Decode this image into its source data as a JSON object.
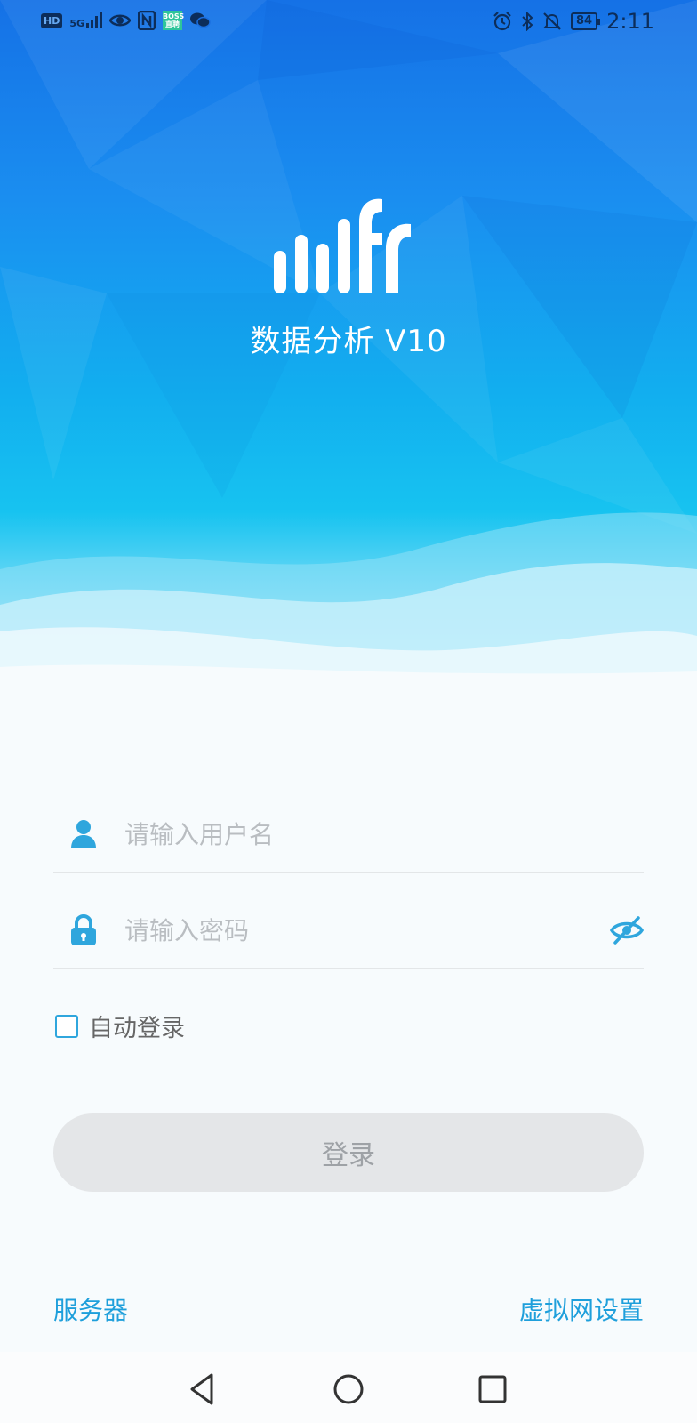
{
  "statusbar": {
    "left_icons": [
      "hd-icon",
      "5g-signal-icon",
      "eye-icon",
      "nfc-icon",
      "boss-app-icon",
      "wechat-icon"
    ],
    "hd_label": "HD",
    "network_label": "5G",
    "boss_label": "BOSS 直聘",
    "right_icons": [
      "alarm-icon",
      "bluetooth-icon",
      "mute-bell-icon",
      "battery-icon"
    ],
    "battery_level": "84",
    "time": "2:11"
  },
  "app": {
    "title": "数据分析 V10",
    "logo": "fr-logo"
  },
  "form": {
    "username": {
      "value": "",
      "placeholder": "请输入用户名",
      "icon": "user-icon"
    },
    "password": {
      "value": "",
      "placeholder": "请输入密码",
      "icon": "lock-icon",
      "toggle_icon": "eye-hidden-icon"
    },
    "auto_login": {
      "label": "自动登录",
      "checked": false
    },
    "login_button": "登录"
  },
  "footer": {
    "server_link": "服务器",
    "vpn_link": "虚拟网设置"
  },
  "navbar": {
    "icons": [
      "back-triangle-icon",
      "home-circle-icon",
      "recents-square-icon"
    ]
  },
  "colors": {
    "accent": "#1e9fdb",
    "hero_top": "#1571e6",
    "hero_bottom": "#17c3f0",
    "button_disabled": "#e4e6e8"
  }
}
